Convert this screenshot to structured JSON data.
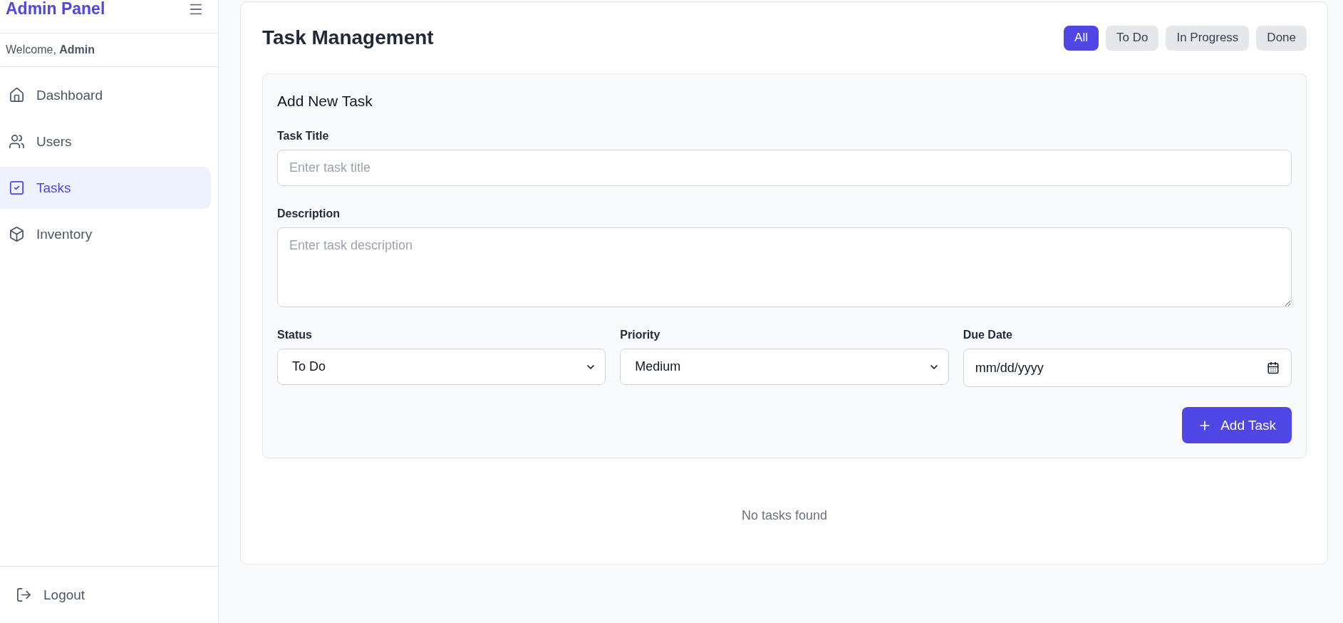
{
  "sidebar": {
    "title": "Admin Panel",
    "welcome": {
      "prefix": "Welcome, ",
      "user": "Admin"
    },
    "items": [
      {
        "label": "Dashboard",
        "kind": "home",
        "selected": false
      },
      {
        "label": "Users",
        "kind": "users",
        "selected": false
      },
      {
        "label": "Tasks",
        "kind": "tasks",
        "selected": true
      },
      {
        "label": "Inventory",
        "kind": "box",
        "selected": false
      }
    ],
    "logout": "Logout"
  },
  "main": {
    "title": "Task Management",
    "filters": [
      {
        "label": "All",
        "selected": true
      },
      {
        "label": "To Do",
        "selected": false
      },
      {
        "label": "In Progress",
        "selected": false
      },
      {
        "label": "Done",
        "selected": false
      }
    ],
    "form": {
      "title": "Add New Task",
      "task_title": {
        "label": "Task Title",
        "placeholder": "Enter task title"
      },
      "description": {
        "label": "Description",
        "placeholder": "Enter task description"
      },
      "status": {
        "label": "Status",
        "value": "To Do"
      },
      "priority": {
        "label": "Priority",
        "value": "Medium"
      },
      "due_date": {
        "label": "Due Date",
        "placeholder": "mm/dd/yyyy"
      },
      "submit": "Add Task"
    },
    "empty": "No tasks found"
  }
}
